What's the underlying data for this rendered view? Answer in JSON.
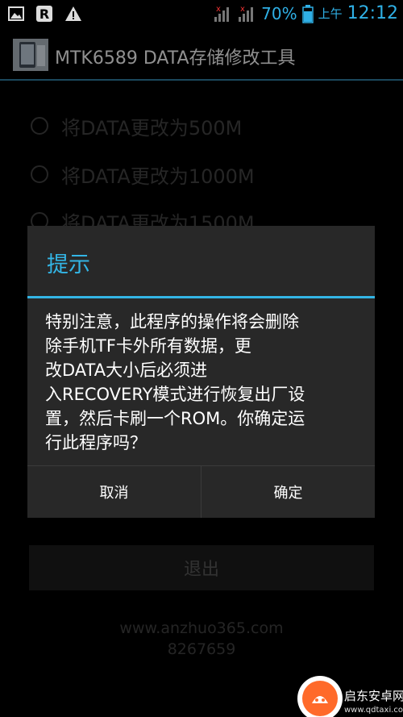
{
  "status_bar": {
    "battery_percent": "70%",
    "ampm": "上午",
    "time": "12:12",
    "accent": "#2fb0e6"
  },
  "app": {
    "title": "MTK6589 DATA存储修改工具"
  },
  "options": [
    {
      "label": "将DATA更改为500M"
    },
    {
      "label": "将DATA更改为1000M"
    },
    {
      "label": "将DATA更改为1500M"
    }
  ],
  "exit_button": {
    "label": "退出"
  },
  "footer": {
    "site": "www.anzhuo365.com",
    "number": "8267659"
  },
  "dialog": {
    "title": "提示",
    "message_lines": [
      "特别注意，此程序的操作将会删除",
      "除手机TF卡外所有数据，更",
      "改DATA大小后必须进",
      "入RECOVERY模式进行恢复出厂设",
      "置，然后卡刷一个ROM。你确定运",
      "行此程序吗？"
    ],
    "cancel_label": "取消",
    "confirm_label": "确定",
    "accent": "#33b5e5"
  },
  "watermark": {
    "name": "启东安卓网",
    "url": "www.qdtaxi.com"
  }
}
